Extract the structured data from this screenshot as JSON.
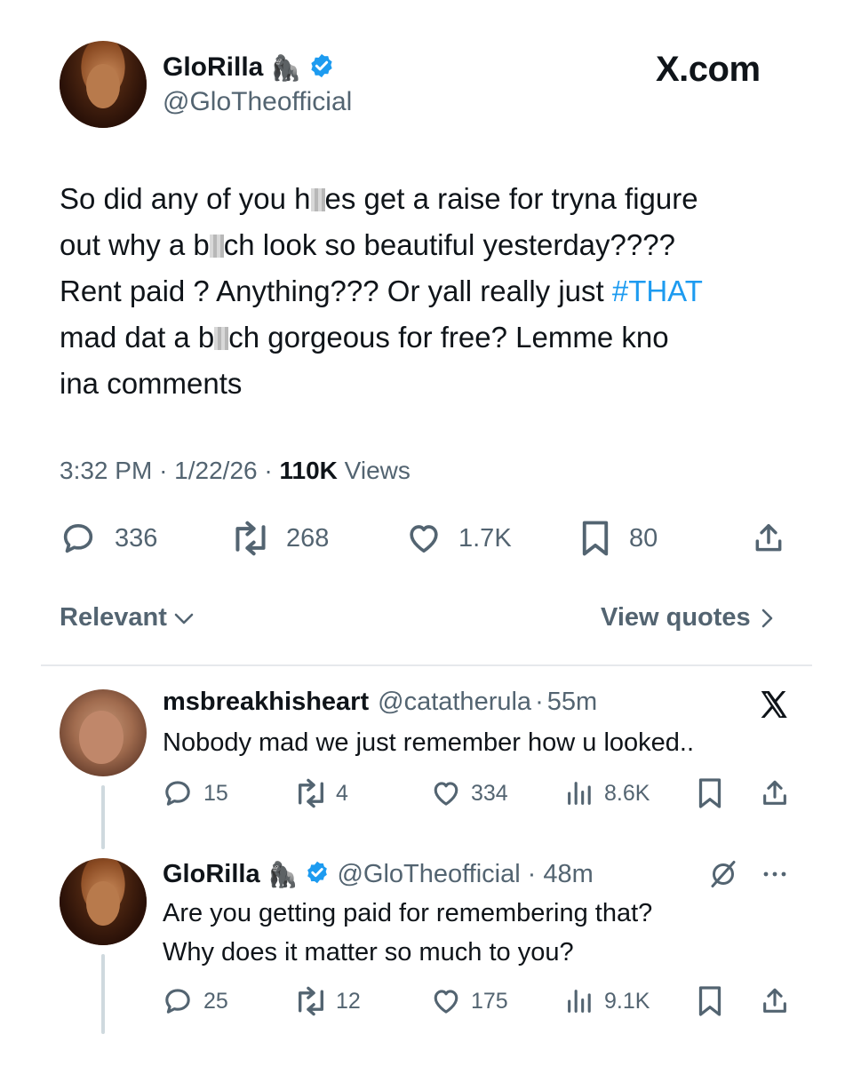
{
  "watermark": "X.com",
  "main_tweet": {
    "author_name": "GloRilla",
    "author_emoji": "🦍",
    "author_handle": "@GloTheofficial",
    "text_parts": {
      "line1a": "So did any of you h",
      "line1b": "es get a raise for tryna figure",
      "line2a": "out why a b",
      "line2b": "ch look so beautiful yesterday????",
      "line3": "Rent paid ? Anything??? Or yall really just ",
      "hashtag": "#THAT",
      "line4a": "mad dat a b",
      "line4b": "ch gorgeous for free? Lemme kno",
      "line5": "ina comments"
    },
    "time": "3:32 PM",
    "date": "1/22/26",
    "views_count": "110K",
    "views_label": "Views",
    "replies": "336",
    "reposts": "268",
    "likes": "1.7K",
    "bookmarks": "80"
  },
  "sort_bar": {
    "relevant_label": "Relevant",
    "view_quotes_label": "View quotes"
  },
  "replies": [
    {
      "display_name": "msbreakhisheart",
      "handle": "@catatherula",
      "age": "55m",
      "text": "Nobody mad we just remember how u looked..",
      "replies": "15",
      "reposts": "4",
      "likes": "334",
      "views": "8.6K"
    },
    {
      "display_name": "GloRilla",
      "emoji": "🦍",
      "handle": "@GloTheofficial",
      "age": "48m",
      "text_line1": "Are you getting paid for remembering that?",
      "text_line2": "Why does it matter so much to you?",
      "replies": "25",
      "reposts": "12",
      "likes": "175",
      "views": "9.1K"
    }
  ],
  "colors": {
    "accent": "#1d9bf0",
    "text": "#0f1419",
    "muted": "#536471"
  }
}
